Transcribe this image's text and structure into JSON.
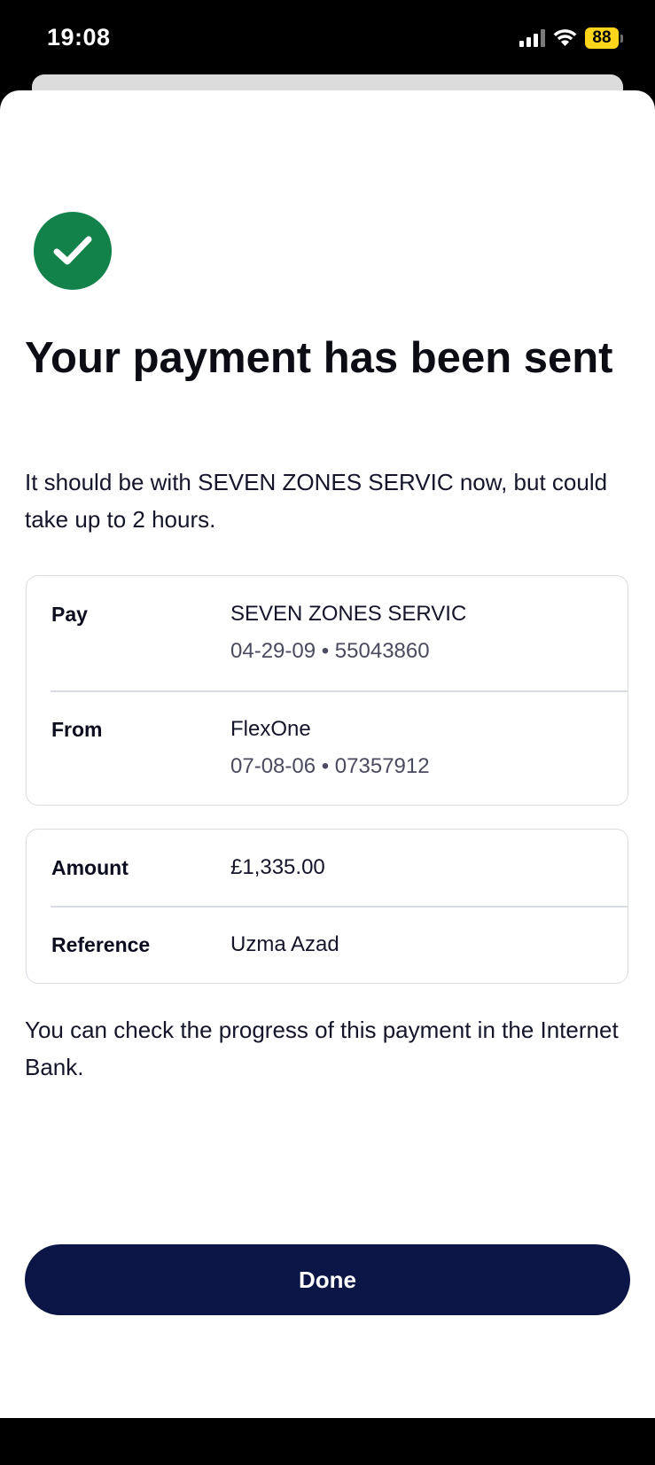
{
  "status_bar": {
    "time": "19:08",
    "battery": "88"
  },
  "confirmation": {
    "title": "Your payment has been sent",
    "subtitle": "It should be with SEVEN ZONES SERVIC now, but could take up to 2 hours."
  },
  "payment_details": {
    "pay_label": "Pay",
    "payee_name": "SEVEN ZONES SERVIC",
    "payee_account": "04-29-09 • 55043860",
    "from_label": "From",
    "from_name": "FlexOne",
    "from_account": "07-08-06 • 07357912"
  },
  "amount_details": {
    "amount_label": "Amount",
    "amount_value": "£1,335.00",
    "reference_label": "Reference",
    "reference_value": "Uzma Azad"
  },
  "note": "You can check the progress of this payment in the Internet Bank.",
  "done_button": "Done",
  "colors": {
    "success": "#13824a",
    "primary": "#0b1646",
    "battery": "#ffd51c"
  },
  "icons": {
    "success": "checkmark-circle-icon"
  }
}
